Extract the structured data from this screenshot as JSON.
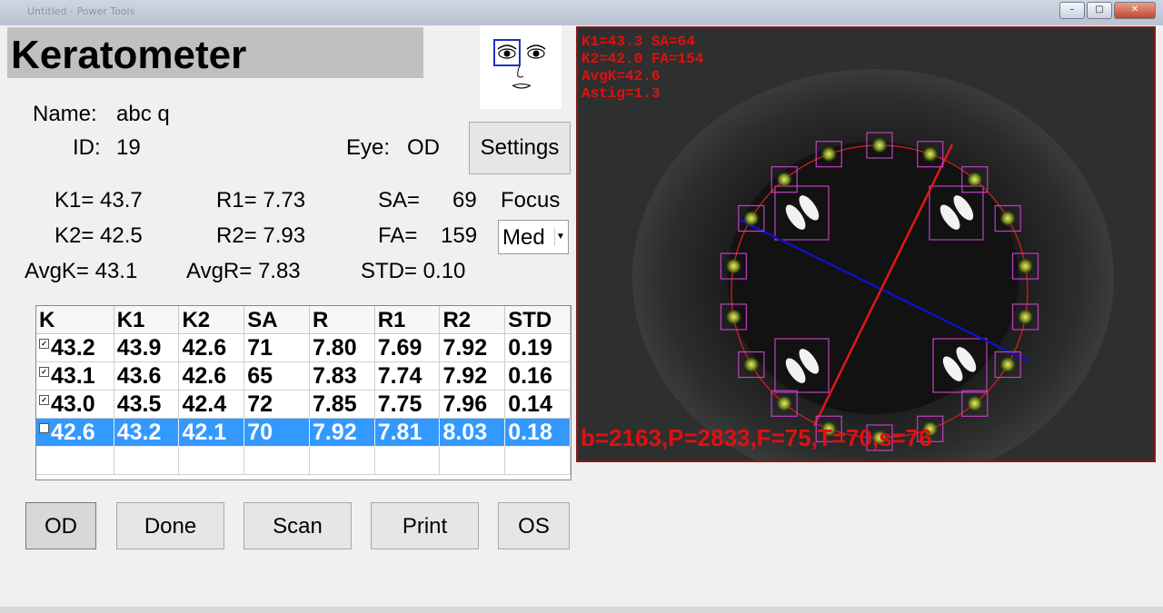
{
  "window": {
    "title": "Untitled - Power Tools",
    "buttons": {
      "minimize": "–",
      "maximize": "□",
      "close": "✕"
    }
  },
  "app": {
    "title": "Keratometer"
  },
  "patient": {
    "name_label": "Name:",
    "name_value": "abc q",
    "id_label": "ID:",
    "id_value": "19",
    "eye_label": "Eye:",
    "eye_value": "OD"
  },
  "settings_button": "Settings",
  "measurements": {
    "k1": "K1= 43.7",
    "k2": "K2= 42.5",
    "avgk": "AvgK= 43.1",
    "r1": "R1= 7.73",
    "r2": "R2= 7.93",
    "avgr": "AvgR= 7.83",
    "sa_label": "SA=",
    "sa_value": "69",
    "fa_label": "FA=",
    "fa_value": "159",
    "std": "STD= 0.10"
  },
  "focus": {
    "label": "Focus",
    "selected": "Med"
  },
  "table": {
    "headers": [
      "K",
      "K1",
      "K2",
      "SA",
      "R",
      "R1",
      "R2",
      "STD"
    ],
    "rows": [
      {
        "checked": true,
        "cells": [
          "43.2",
          "43.9",
          "42.6",
          "71",
          "7.80",
          "7.69",
          "7.92",
          "0.19"
        ]
      },
      {
        "checked": true,
        "cells": [
          "43.1",
          "43.6",
          "42.6",
          "65",
          "7.83",
          "7.74",
          "7.92",
          "0.16"
        ]
      },
      {
        "checked": true,
        "cells": [
          "43.0",
          "43.5",
          "42.4",
          "72",
          "7.85",
          "7.75",
          "7.96",
          "0.14"
        ]
      },
      {
        "checked": false,
        "selected": true,
        "cells": [
          "42.6",
          "43.2",
          "42.1",
          "70",
          "7.92",
          "7.81",
          "8.03",
          "0.18"
        ]
      }
    ]
  },
  "bottom_buttons": {
    "od": "OD",
    "done": "Done",
    "scan": "Scan",
    "print": "Print",
    "os": "OS"
  },
  "camera": {
    "overlay_lines": [
      "K1=43.3 SA=64",
      "K2=42.0 FA=154",
      "AvgK=42.6",
      "Astig=1.3"
    ],
    "bottom_text": "b=2163,P=2833,F=75,T=70,s=76",
    "colors": {
      "overlay_text": "#e01010",
      "ring": "#d02020",
      "axis_line_1": "#1010c0",
      "axis_line_2": "#e01818",
      "marker_box": "#c040c0",
      "marker_dot": "#c8d020"
    }
  }
}
